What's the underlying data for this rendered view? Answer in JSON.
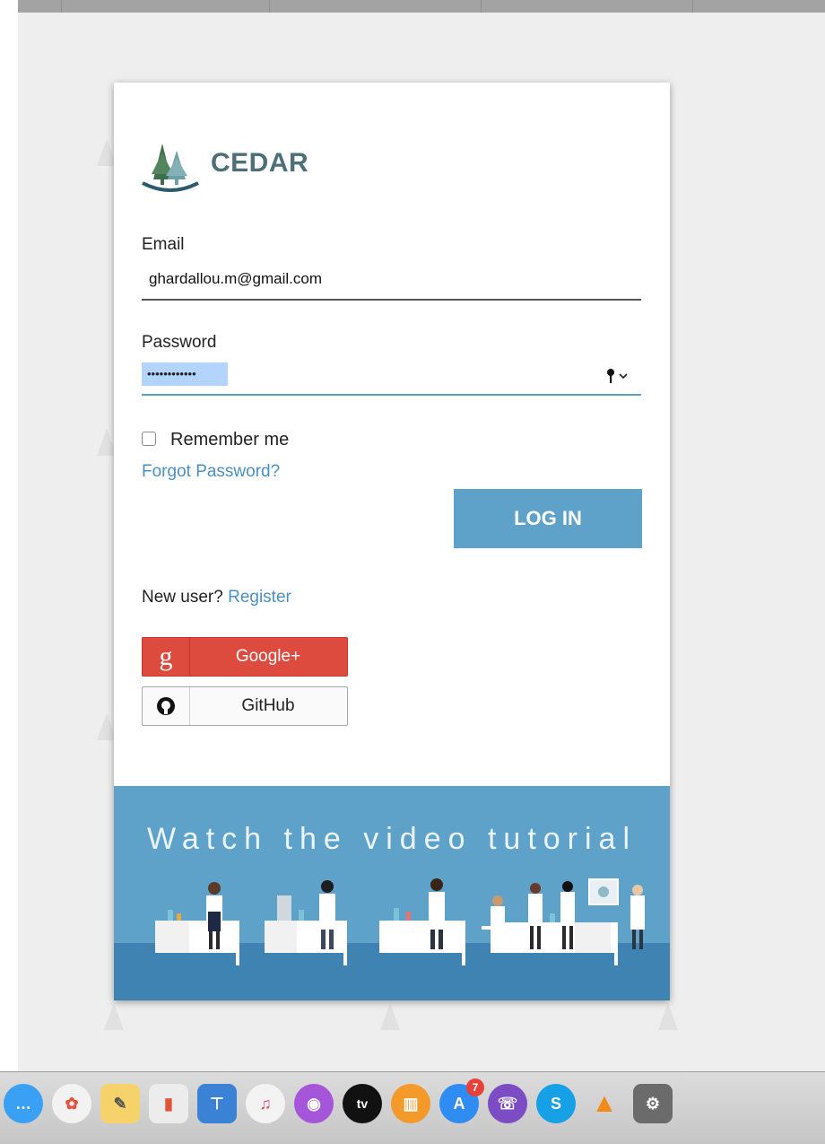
{
  "brand": {
    "name": "CEDAR"
  },
  "form": {
    "email_label": "Email",
    "email_value": "ghardallou.m@gmail.com",
    "password_label": "Password",
    "password_value": "••••••••••••",
    "remember_label": "Remember me",
    "remember_checked": false,
    "forgot_label": "Forgot Password?",
    "login_label": "LOG IN",
    "new_user_text": "New user?",
    "register_label": "Register"
  },
  "social": {
    "google_icon": "g",
    "google_label": "Google+",
    "github_label": "GitHub"
  },
  "banner": {
    "text": "Watch the video tutorial"
  },
  "dock": {
    "items": [
      {
        "name": "messages-icon",
        "glyph": "…"
      },
      {
        "name": "photos-icon",
        "glyph": "✿"
      },
      {
        "name": "textedit-icon",
        "glyph": "✎"
      },
      {
        "name": "numbers-icon",
        "glyph": "▮"
      },
      {
        "name": "keynote-icon",
        "glyph": "⊤"
      },
      {
        "name": "music-icon",
        "glyph": "♫"
      },
      {
        "name": "podcasts-icon",
        "glyph": "◉"
      },
      {
        "name": "appletv-icon",
        "glyph": "tv"
      },
      {
        "name": "books-icon",
        "glyph": "▥"
      },
      {
        "name": "appstore-icon",
        "glyph": "A",
        "badge": "7"
      },
      {
        "name": "viber-icon",
        "glyph": "☏"
      },
      {
        "name": "skype-icon",
        "glyph": "S"
      },
      {
        "name": "vlc-icon",
        "glyph": "▲"
      },
      {
        "name": "system-preferences-icon",
        "glyph": "⚙"
      }
    ]
  },
  "colors": {
    "accent": "#5fa2c9",
    "link": "#4a90c2",
    "google": "#dc4b3e",
    "brand_text": "#4d6f78"
  }
}
